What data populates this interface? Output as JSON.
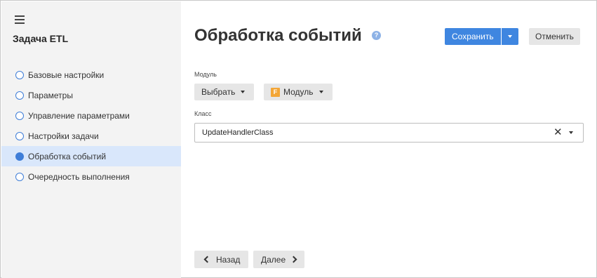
{
  "sidebar": {
    "title": "Задача ETL",
    "items": [
      {
        "label": "Базовые настройки",
        "active": false
      },
      {
        "label": "Параметры",
        "active": false
      },
      {
        "label": "Управление параметрами",
        "active": false
      },
      {
        "label": "Настройки задачи",
        "active": false
      },
      {
        "label": "Обработка событий",
        "active": true
      },
      {
        "label": "Очередность выполнения",
        "active": false
      }
    ]
  },
  "header": {
    "title": "Обработка событий",
    "help_icon": "?",
    "save_label": "Сохранить",
    "cancel_label": "Отменить"
  },
  "module": {
    "label": "Модуль",
    "select_label": "Выбрать",
    "module_button_label": "Модуль",
    "module_icon_letter": "F"
  },
  "class_field": {
    "label": "Класс",
    "value": "UpdateHandlerClass",
    "clear_icon": "✕"
  },
  "footer": {
    "back_label": "Назад",
    "next_label": "Далее"
  },
  "colors": {
    "accent": "#3f86e0",
    "active_item_bg": "#d9e7fb",
    "sidebar_bg": "#f3f3f3",
    "module_icon": "#f3a637"
  }
}
